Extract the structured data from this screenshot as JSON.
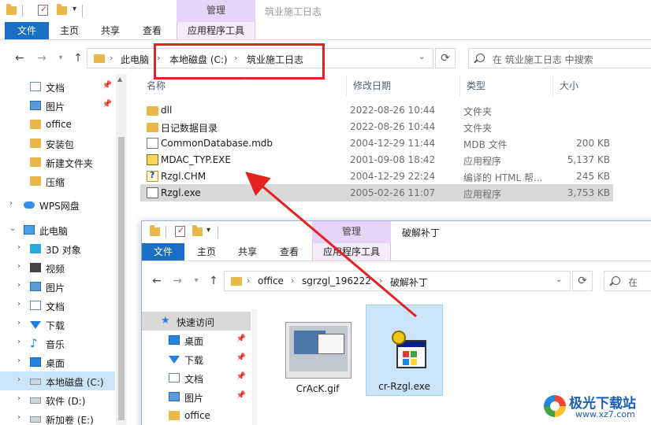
{
  "window1": {
    "quick_access_arrow": "▾",
    "ribbon_context": "管理",
    "title": "筑业施工日志",
    "tabs": [
      "文件",
      "主页",
      "共享",
      "查看",
      "应用程序工具"
    ],
    "address": {
      "segments": [
        "此电脑",
        "本地磁盘 (C:)",
        "筑业施工日志"
      ]
    },
    "search_placeholder": "在 筑业施工日志 中搜索",
    "nav": [
      {
        "label": "文档",
        "icon": "document-icon",
        "pinned": true
      },
      {
        "label": "图片",
        "icon": "picture-icon",
        "pinned": true
      },
      {
        "label": "office",
        "icon": "folder-icon"
      },
      {
        "label": "安装包",
        "icon": "folder-icon"
      },
      {
        "label": "新建文件夹",
        "icon": "folder-icon"
      },
      {
        "label": "压缩",
        "icon": "folder-icon"
      },
      {
        "label": "WPS网盘",
        "icon": "cloud-icon"
      },
      {
        "label": "此电脑",
        "icon": "computer-icon"
      },
      {
        "label": "3D 对象",
        "icon": "3d-objects-icon"
      },
      {
        "label": "视频",
        "icon": "video-icon"
      },
      {
        "label": "图片",
        "icon": "picture-icon"
      },
      {
        "label": "文档",
        "icon": "document-icon"
      },
      {
        "label": "下载",
        "icon": "download-icon"
      },
      {
        "label": "音乐",
        "icon": "music-icon"
      },
      {
        "label": "桌面",
        "icon": "desktop-icon"
      },
      {
        "label": "本地磁盘 (C:)",
        "icon": "drive-icon",
        "selected": true
      },
      {
        "label": "软件 (D:)",
        "icon": "drive-icon"
      },
      {
        "label": "新加卷 (E:)",
        "icon": "drive-icon"
      }
    ],
    "columns": [
      "名称",
      "修改日期",
      "类型",
      "大小"
    ],
    "files": [
      {
        "name": "dll",
        "date": "2022-08-26 10:44",
        "type": "文件夹",
        "size": "",
        "icon": "folder-icon"
      },
      {
        "name": "日记数据目录",
        "date": "2022-08-26 10:44",
        "type": "文件夹",
        "size": "",
        "icon": "folder-icon"
      },
      {
        "name": "CommonDatabase.mdb",
        "date": "2004-12-29 11:44",
        "type": "MDB 文件",
        "size": "200 KB",
        "icon": "file-icon"
      },
      {
        "name": "MDAC_TYP.EXE",
        "date": "2001-09-08 18:42",
        "type": "应用程序",
        "size": "5,137 KB",
        "icon": "installer-icon"
      },
      {
        "name": "Rzgl.CHM",
        "date": "2004-12-29 22:24",
        "type": "编译的 HTML 帮...",
        "size": "245 KB",
        "icon": "help-file-icon"
      },
      {
        "name": "Rzgl.exe",
        "date": "2005-02-26 11:07",
        "type": "应用程序",
        "size": "3,753 KB",
        "icon": "application-icon",
        "selected": true
      }
    ]
  },
  "window2": {
    "quick_access_arrow": "▾",
    "ribbon_context": "管理",
    "title": "破解补丁",
    "tabs": [
      "文件",
      "主页",
      "共享",
      "查看",
      "应用程序工具"
    ],
    "address": {
      "segments": [
        "office",
        "sgrzgl_196222",
        "破解补丁"
      ]
    },
    "search_placeholder": "在",
    "nav": [
      {
        "label": "快速访问",
        "icon": "star-icon",
        "selected": true
      },
      {
        "label": "桌面",
        "icon": "desktop-icon",
        "pinned": true
      },
      {
        "label": "下载",
        "icon": "download-icon",
        "pinned": true
      },
      {
        "label": "文档",
        "icon": "document-icon",
        "pinned": true
      },
      {
        "label": "图片",
        "icon": "picture-icon",
        "pinned": true
      },
      {
        "label": "office",
        "icon": "folder-icon"
      }
    ],
    "items": [
      {
        "name": "CrAcK.gif",
        "icon": "gif-thumbnail"
      },
      {
        "name": "cr-Rzgl.exe",
        "icon": "application-icon",
        "selected": true
      }
    ]
  },
  "watermark": {
    "brand": "极光下载站",
    "url": "www.xz7.com"
  },
  "colors": {
    "file_tab": "#1a6fc4",
    "manage_context": "#e7d4f6",
    "selection": "#cce4f7",
    "annotation": "#e32222"
  }
}
